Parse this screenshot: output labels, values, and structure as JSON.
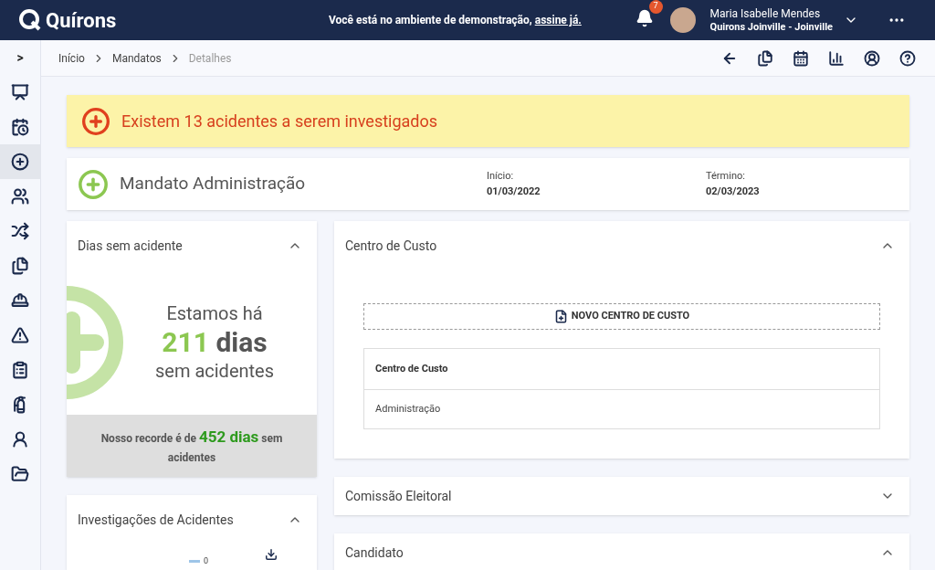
{
  "header": {
    "brand": "Quírons",
    "demo_notice": "Você está no ambiente de demonstração, ",
    "demo_link": "assine já.",
    "notification_count": "7",
    "user_name": "Maria Isabelle Mendes",
    "user_org": "Quirons Joinville - Joinville"
  },
  "sidebar": {
    "toggle": ">",
    "items": [
      {
        "kind": "dashboard",
        "selected": false
      },
      {
        "kind": "calendar",
        "selected": false
      },
      {
        "kind": "plus",
        "selected": true
      },
      {
        "kind": "people",
        "selected": false
      },
      {
        "kind": "shuffle",
        "selected": false
      },
      {
        "kind": "files",
        "selected": false
      },
      {
        "kind": "helmet",
        "selected": false
      },
      {
        "kind": "warning",
        "selected": false
      },
      {
        "kind": "clipboard",
        "selected": false
      },
      {
        "kind": "extinguisher",
        "selected": false
      },
      {
        "kind": "worker",
        "selected": false
      },
      {
        "kind": "folder",
        "selected": false
      }
    ]
  },
  "breadcrumb": [
    {
      "label": "Início",
      "current": false
    },
    {
      "label": "Mandatos",
      "current": false
    },
    {
      "label": "Detalhes",
      "current": true
    }
  ],
  "alert": {
    "text": "Existem 13 acidentes a serem investigados"
  },
  "mandate": {
    "title": "Mandato Administração",
    "start_label": "Início:",
    "start_value": "01/03/2022",
    "end_label": "Término:",
    "end_value": "02/03/2023"
  },
  "days_panel": {
    "title": "Dias sem acidente",
    "expanded": true,
    "line1": "Estamos há",
    "count": "211",
    "unit": "dias",
    "line3": "sem acidentes",
    "record_prefix": "Nosso recorde é de ",
    "record_value": "452 dias",
    "record_suffix": " sem acidentes"
  },
  "investigations_panel": {
    "title": "Investigações de Acidentes",
    "expanded": true,
    "legend_value": "0"
  },
  "cost_center_panel": {
    "title": "Centro de Custo",
    "expanded": true,
    "new_button": "NOVO CENTRO DE CUSTO",
    "column": "Centro de Custo",
    "rows": [
      "Administração"
    ]
  },
  "election_panel": {
    "title": "Comissão Eleitoral",
    "expanded": false
  },
  "candidate_panel": {
    "title": "Candidato",
    "expanded": true
  }
}
